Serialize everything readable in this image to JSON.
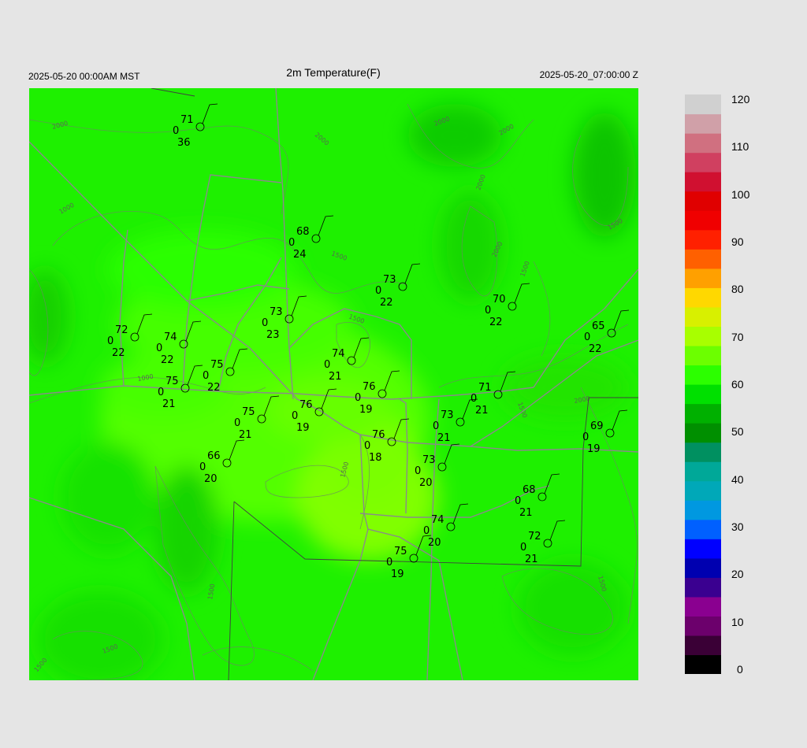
{
  "header": {
    "title": "2m Temperature(F)",
    "left_label": "2025-05-20 00:00AM MST",
    "right_label": "2025-05-20_07:00:00 Z"
  },
  "colorbar": {
    "ticks": [
      "120",
      "110",
      "100",
      "90",
      "80",
      "70",
      "60",
      "50",
      "40",
      "30",
      "20",
      "10",
      "0"
    ],
    "range": [
      0,
      120
    ],
    "colors": [
      "#000000",
      "#3a0036",
      "#6c006c",
      "#8a0090",
      "#3a0090",
      "#0000b0",
      "#0000ff",
      "#0060ff",
      "#0098e0",
      "#00a8b8",
      "#00a898",
      "#009060",
      "#008f00",
      "#00b000",
      "#00e000",
      "#2cff00",
      "#6cff00",
      "#a8ff00",
      "#d8f000",
      "#ffd800",
      "#ffa000",
      "#ff6000",
      "#ff2000",
      "#f00000",
      "#e00000",
      "#d01030",
      "#d04060",
      "#d07080",
      "#d0a0a8",
      "#d0d0d0"
    ]
  },
  "stations": [
    {
      "t": "71",
      "v": "0",
      "d": "36"
    },
    {
      "t": "68",
      "v": "0",
      "d": "24"
    },
    {
      "t": "73",
      "v": "0",
      "d": "22"
    },
    {
      "t": "70",
      "v": "0",
      "d": "22"
    },
    {
      "t": "73",
      "v": "0",
      "d": "23"
    },
    {
      "t": "72",
      "v": "0",
      "d": "22"
    },
    {
      "t": "74",
      "v": "0",
      "d": "22"
    },
    {
      "t": "65",
      "v": "0",
      "d": "22"
    },
    {
      "t": "74",
      "v": "0",
      "d": "21"
    },
    {
      "t": "75",
      "v": "0",
      "d": "22"
    },
    {
      "t": "76",
      "v": "0",
      "d": "19"
    },
    {
      "t": "75",
      "v": "0",
      "d": "21"
    },
    {
      "t": "71",
      "v": "0",
      "d": "21"
    },
    {
      "t": "76",
      "v": "0",
      "d": "19"
    },
    {
      "t": "75",
      "v": "0",
      "d": "21"
    },
    {
      "t": "73",
      "v": "0",
      "d": "21"
    },
    {
      "t": "69",
      "v": "0",
      "d": "19"
    },
    {
      "t": "76",
      "v": "0",
      "d": "18"
    },
    {
      "t": "66",
      "v": "0",
      "d": "20"
    },
    {
      "t": "73",
      "v": "0",
      "d": "20"
    },
    {
      "t": "68",
      "v": "0",
      "d": "21"
    },
    {
      "t": "74",
      "v": "0",
      "d": "20"
    },
    {
      "t": "72",
      "v": "0",
      "d": "21"
    },
    {
      "t": "75",
      "v": "0",
      "d": "19"
    }
  ],
  "contour_labels": [
    "2000",
    "2000",
    "2000",
    "2000",
    "2000",
    "2000",
    "1500",
    "1500",
    "1500",
    "1000",
    "1000",
    "1500",
    "2000",
    "1500",
    "1500",
    "1500",
    "1500",
    "1500",
    "1500"
  ]
}
